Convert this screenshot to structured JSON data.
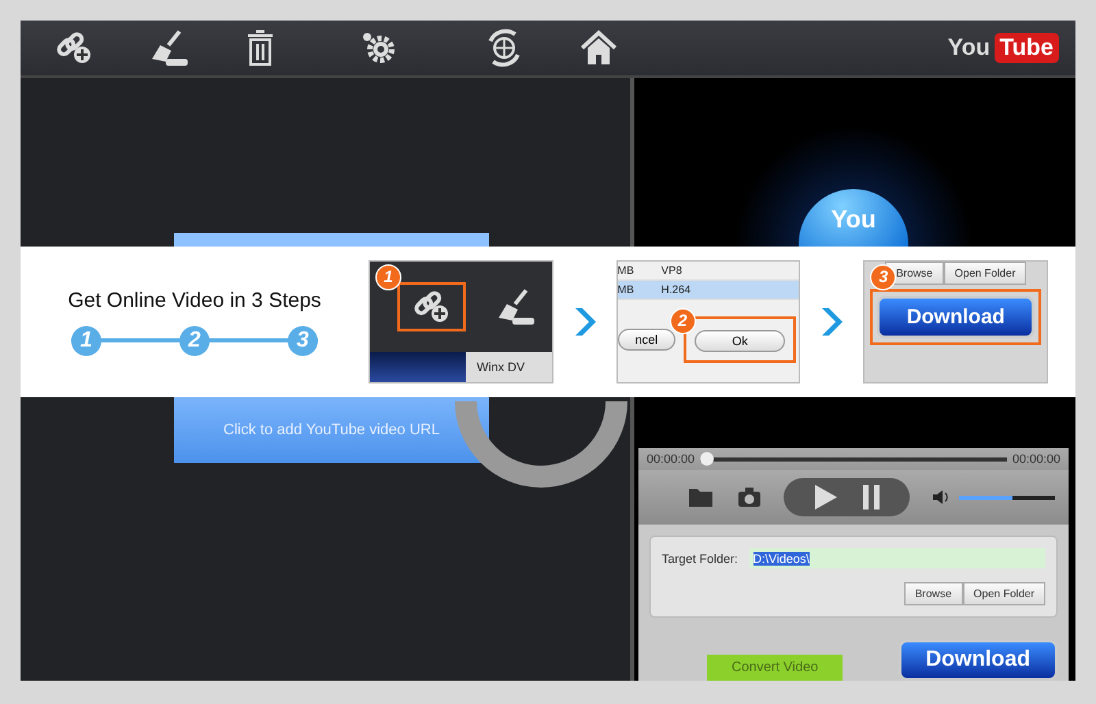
{
  "logo": {
    "you": "You",
    "tube": "Tube"
  },
  "add_url_button": {
    "label": "Click to add YouTube video URL"
  },
  "preview": {
    "logo_text": "You"
  },
  "player": {
    "time_elapsed": "00:00:00",
    "time_total": "00:00:00",
    "seek": {
      "level": 0
    },
    "volume": {
      "level": 0.55
    }
  },
  "target_folder": {
    "label": "Target Folder:",
    "value": "D:\\Videos\\"
  },
  "folder_buttons": [
    "Browse",
    "Open Folder"
  ],
  "convert_button": {
    "label": "Convert Video"
  },
  "download_button": {
    "label": "Download"
  },
  "steps_banner": {
    "title": "Get Online Video in 3 Steps",
    "step_numbers": [
      "1",
      "2",
      "3"
    ],
    "steps": [
      {
        "kind": "toolbar",
        "number": "1",
        "caption": "Winx DV"
      },
      {
        "kind": "dialog",
        "number": "2",
        "rows": [
          {
            "size": "MB",
            "codec": "VP8",
            "selected": false
          },
          {
            "size": "MB",
            "codec": "H.264",
            "selected": true
          }
        ],
        "cancel": "ncel",
        "ok": "Ok"
      },
      {
        "kind": "download",
        "number": "3",
        "buttons": [
          "Browse",
          "Open Folder"
        ],
        "download": "Download"
      }
    ]
  }
}
